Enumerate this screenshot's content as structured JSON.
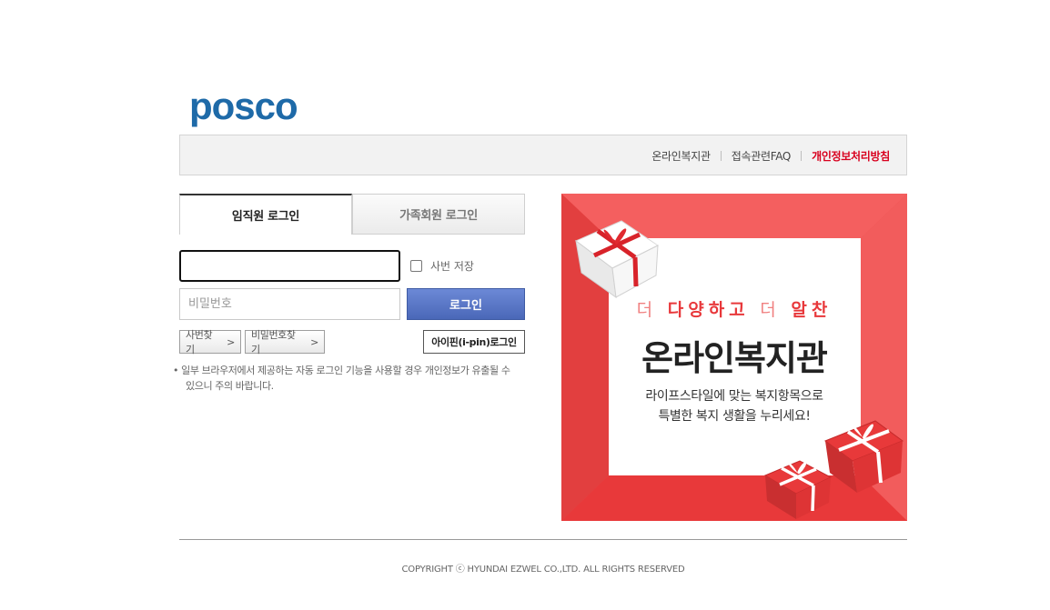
{
  "brand": {
    "logo_text": "posco",
    "color": "#1e6aa8"
  },
  "topnav": {
    "items": [
      {
        "label": "온라인복지관"
      },
      {
        "label": "접속관련FAQ"
      },
      {
        "label": "개인정보처리방침"
      }
    ]
  },
  "tabs": [
    {
      "label": "임직원 로그인",
      "active": true
    },
    {
      "label": "가족회원 로그인",
      "active": false
    }
  ],
  "login": {
    "id_value": "",
    "password_placeholder": "비밀번호",
    "save_id_label": "사번 저장",
    "save_id_checked": false,
    "login_button": "로그인",
    "find_id_button": "사번찾기",
    "find_password_button": "비밀번호찾기",
    "ipin_button": "아이핀(i-pin)로그인",
    "notice_line1": "일부 브라우저에서 제공하는 자동 로그인 기능을 사용할 경우 개인정보가 유출될 수",
    "notice_line2": "있으니 주의 바랍니다."
  },
  "banner": {
    "subtitle_1": "더",
    "subtitle_2": "다양하고",
    "subtitle_3": "더",
    "subtitle_4": "알찬",
    "title": "온라인복지관",
    "desc_line1": "라이프스타일에 맞는 복지항목으로",
    "desc_line2": "특별한 복지 생활을 누리세요!",
    "background_color": "#ef4a4a"
  },
  "footer": {
    "copyright": "COPYRIGHT ⓒ HYUNDAI EZWEL CO.,LTD. ALL RIGHTS RESERVED"
  }
}
